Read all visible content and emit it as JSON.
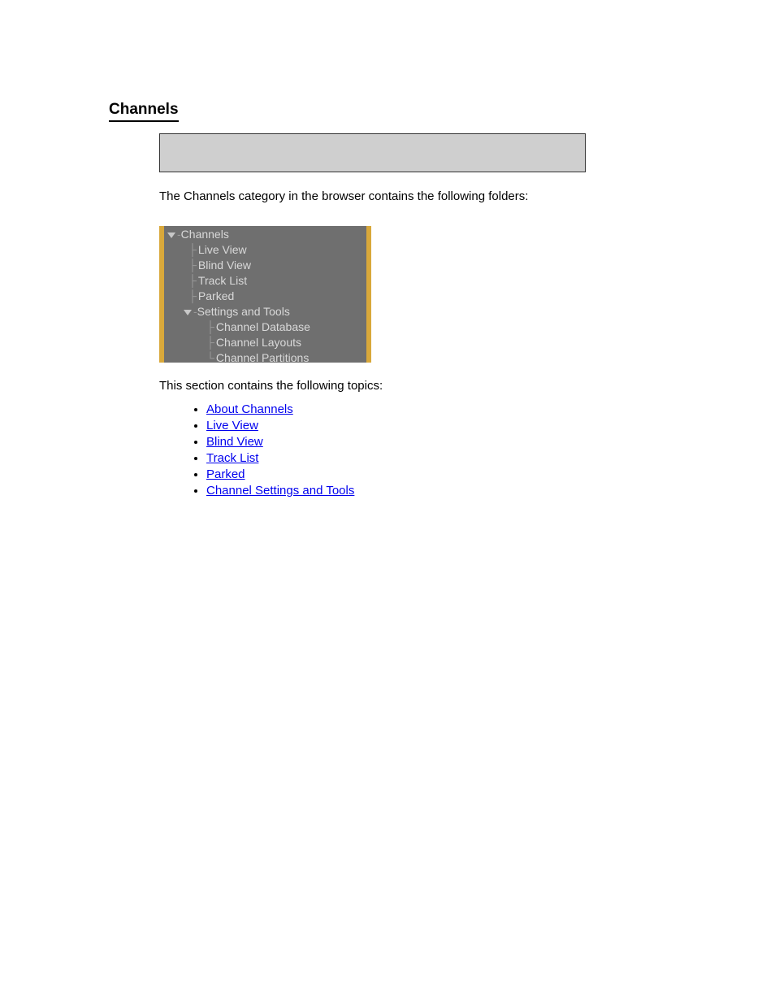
{
  "section": {
    "title": "Channels",
    "intro": "The Channels category in the browser contains the following folders:"
  },
  "ui_tree": {
    "root": "Channels",
    "children": [
      "Live View",
      "Blind View",
      "Track List",
      "Parked"
    ],
    "sub_root": "Settings and Tools",
    "sub_children": [
      "Channel Database",
      "Channel Layouts",
      "Channel Partitions"
    ]
  },
  "topics": {
    "intro": "This section contains the following topics:",
    "items": [
      "About Channels",
      "Live View",
      "Blind View",
      "Track List",
      "Parked",
      "Channel Settings and Tools"
    ]
  }
}
